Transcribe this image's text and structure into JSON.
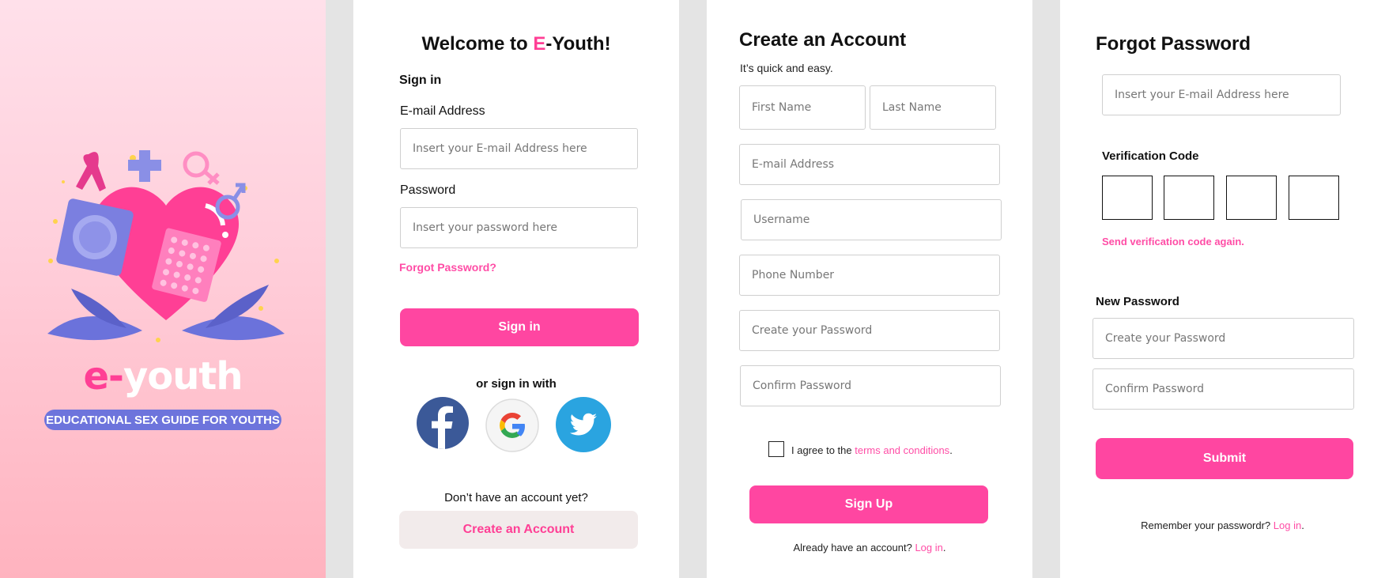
{
  "brand": {
    "logo_prefix": "e-",
    "logo_suffix": "youth",
    "tagline": "EDUCATIONAL SEX GUIDE FOR YOUTHS"
  },
  "signin": {
    "title_prefix": "Welcome to ",
    "title_accent": "E",
    "title_suffix": "-Youth!",
    "subtitle": "Sign in",
    "email_label": "E-mail Address",
    "email_placeholder": "Insert your E-mail Address here",
    "password_label": "Password",
    "password_placeholder": "Insert your password here",
    "forgot_link": "Forgot Password?",
    "signin_button": "Sign in",
    "social_caption": "or sign in with",
    "no_account_text": "Don’t have an account yet?",
    "create_account_button": "Create an Account"
  },
  "signup": {
    "title": "Create an Account",
    "subtitle": "It’s quick and easy.",
    "first_name_placeholder": "First Name",
    "last_name_placeholder": "Last Name",
    "email_placeholder": "E-mail Address",
    "username_placeholder": "Username",
    "phone_placeholder": "Phone Number",
    "password_placeholder": "Create your Password",
    "confirm_placeholder": "Confirm Password",
    "agree_text": "I agree to the ",
    "terms_link": "terms and conditions",
    "agree_end": ".",
    "signup_button": "Sign Up",
    "have_account_text": "Already have an account? ",
    "login_link": "Log in",
    "login_end": "."
  },
  "forgot": {
    "title": "Forgot Password",
    "email_placeholder": "Insert your E-mail Address here",
    "verification_label": "Verification Code",
    "resend_link": "Send verification code again.",
    "new_password_label": "New Password",
    "password_placeholder": "Create your Password",
    "confirm_placeholder": "Confirm Password",
    "submit_button": "Submit",
    "remember_text": "Remember your passwordr? ",
    "login_link": "Log in",
    "login_end": "."
  },
  "colors": {
    "accent": "#ff46a1",
    "link": "#ff4da6",
    "splash_top": "#ffe0ea",
    "splash_bottom": "#ffb3bf",
    "purple": "#7b7fe0"
  },
  "icons": [
    "ribbon-icon",
    "plus-icon",
    "female-icon",
    "male-icon",
    "heart-icon",
    "condom-icon",
    "pill-pack-icon",
    "facebook-icon",
    "google-icon",
    "twitter-icon"
  ]
}
